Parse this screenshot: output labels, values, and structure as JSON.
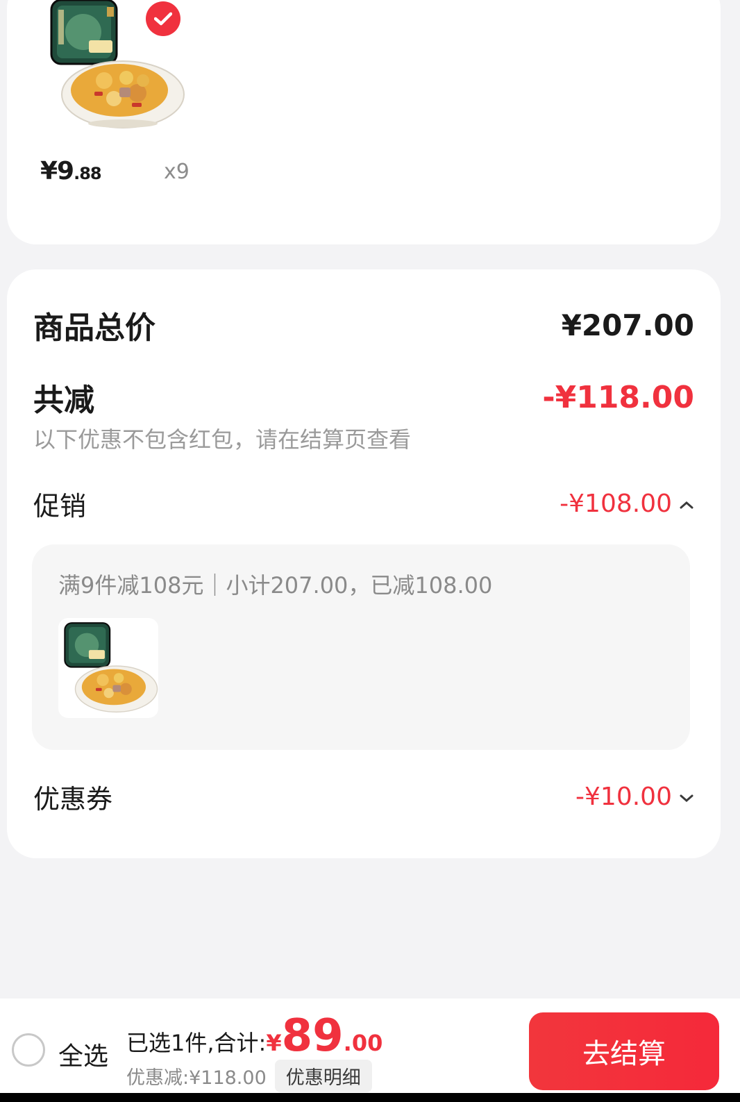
{
  "product": {
    "price_int": "¥9",
    "price_dec": ".88",
    "quantity": "x9",
    "image_icon": "pickled-peppers-product-image",
    "selected": true
  },
  "summary": {
    "total_label": "商品总价",
    "total_value": "¥207.00",
    "reduce_label": "共减",
    "reduce_value": "-¥118.00",
    "note": "以下优惠不包含红包，请在结算页查看",
    "promo_label": "促销",
    "promo_value": "-¥108.00",
    "promo_detail": "满9件减108元｜小计207.00，已减108.00",
    "coupon_label": "优惠券",
    "coupon_value": "-¥10.00"
  },
  "bottom": {
    "select_all": "全选",
    "selected_summary": "已选1件,合计:",
    "total_yen": "¥",
    "total_int": "89",
    "total_dec": ".00",
    "discount_text": "优惠减:¥118.00",
    "discount_detail_button": "优惠明细",
    "checkout_button": "去结算"
  },
  "colors": {
    "accent_red": "#f0313e",
    "background": "#f3f3f5",
    "card": "#ffffff"
  }
}
